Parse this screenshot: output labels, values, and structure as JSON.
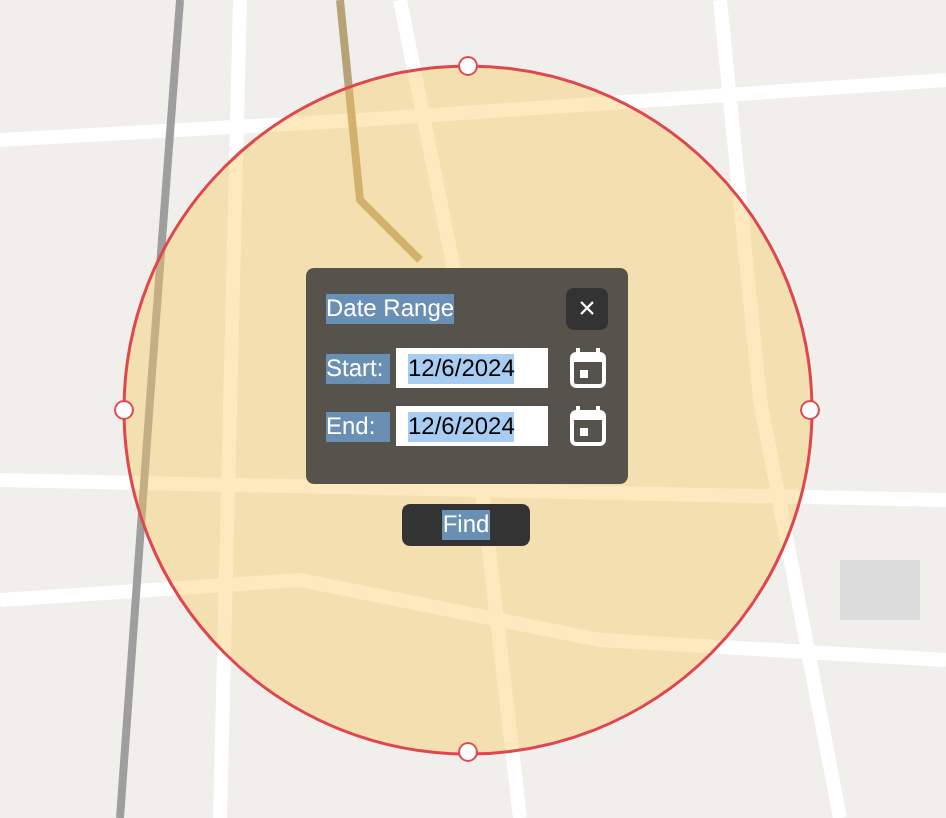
{
  "dialog": {
    "title": "Date Range",
    "close": "×",
    "fields": [
      {
        "label": "Start:",
        "value": "12/6/2024"
      },
      {
        "label": "End:",
        "value": "12/6/2024"
      }
    ]
  },
  "find_button": "Find"
}
